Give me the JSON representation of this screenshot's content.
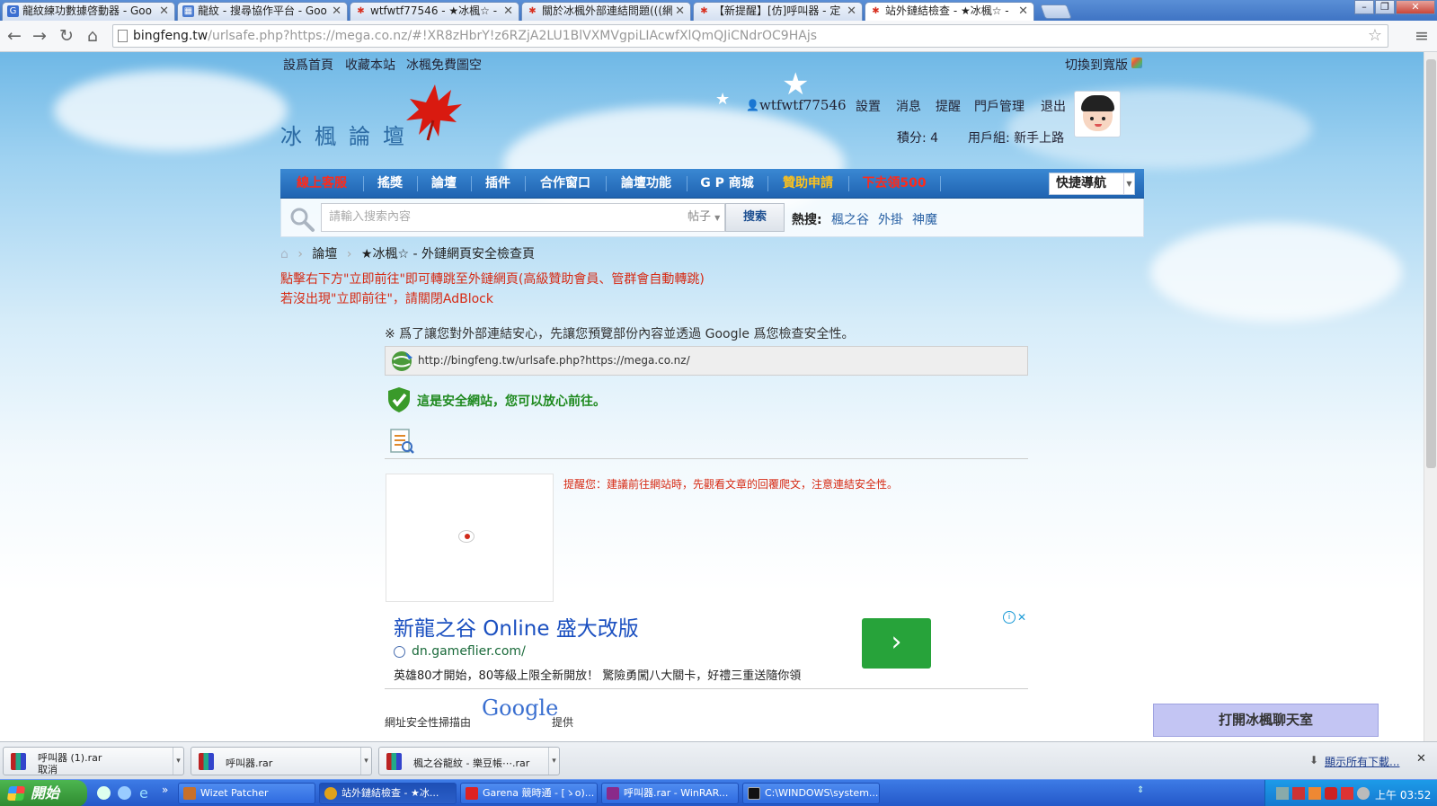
{
  "browser": {
    "tabs": [
      {
        "label": "龍紋練功數據啓動器 - Goo",
        "favicon": "G",
        "favcolor": "#3b6fd1"
      },
      {
        "label": "龍紋 - 搜尋協作平台 - Goo",
        "favicon": "▦",
        "favcolor": "#4a7bd0"
      },
      {
        "label": "wtfwtf77546 - ★冰楓☆ - 網",
        "favicon": "✱",
        "favcolor": "#d83020"
      },
      {
        "label": "關於冰楓外部連結問題(((網",
        "favicon": "✱",
        "favcolor": "#d83020"
      },
      {
        "label": "【新提醒】[仿]呼叫器 - 定",
        "favicon": "✱",
        "favcolor": "#d83020"
      },
      {
        "label": "站外鏈結檢查 - ★冰楓☆ -",
        "favicon": "✱",
        "favcolor": "#d83020"
      }
    ],
    "address_host": "bingfeng.tw",
    "address_path": "/urlsafe.php?https://mega.co.nz/#!XR8zHbrY!z6RZjA2LU1BlVXMVgpiLIAcwfXlQmQJiCNdrOC9HAjs"
  },
  "site": {
    "top_links": [
      "設爲首頁",
      "收藏本站",
      "冰楓免費圖空"
    ],
    "switch_wide": "切換到寬版",
    "logo_text": "冰楓論壇",
    "username": "wtfwtf77546",
    "user_links": [
      "設置",
      "消息",
      "提醒",
      "門戶管理",
      "退出"
    ],
    "points_label": "積分: 4",
    "user_group": "用戶組: 新手上路",
    "nav": [
      {
        "label": "線上客服",
        "color": "#ff2a1a"
      },
      {
        "label": "搖獎",
        "color": "#ffffff"
      },
      {
        "label": "論壇",
        "color": "#ffffff"
      },
      {
        "label": "插件",
        "color": "#ffffff"
      },
      {
        "label": "合作窗口",
        "color": "#ffffff"
      },
      {
        "label": "論壇功能",
        "color": "#ffffff"
      },
      {
        "label": "G P 商城",
        "color": "#ffffff"
      },
      {
        "label": "贊助申請",
        "color": "#ffc21a"
      },
      {
        "label": "下去領500",
        "color": "#ff2a1a"
      }
    ],
    "quick_nav": "快捷導航",
    "search_placeholder": "請輸入搜索內容",
    "search_type": "帖子",
    "search_button": "搜索",
    "hot_label": "熱搜:",
    "hot_terms": [
      "楓之谷",
      "外掛",
      "神魔"
    ],
    "breadcrumb": [
      "論壇",
      "★冰楓☆ - 外鏈網頁安全檢查頁"
    ],
    "notice_line1": "點擊右下方\"立即前往\"即可轉跳至外鏈網頁(高級贊助會員、管群會自動轉跳)",
    "notice_line2": "若沒出現\"立即前往\"，請關閉AdBlock",
    "intro": "※ 爲了讓您對外部連結安心，先讓您預覽部份內容並透過 Google 爲您檢查安全性。",
    "checked_url": "http://bingfeng.tw/urlsafe.php?https://mega.co.nz/",
    "safe_text": "這是安全網站，您可以放心前往。",
    "reminder": "提醒您：建議前往網站時，先觀看文章的回覆爬文，注意連結安全性。",
    "ad": {
      "title": "新龍之谷 Online 盛大改版",
      "url": "dn.gameflier.com/",
      "desc": "英雄80才開始，80等級上限全新開放！ 驚險勇闖八大關卡，好禮三重送隨你領"
    },
    "google_credit_prefix": "網址安全性掃描由",
    "google_logo": "Google",
    "google_credit_suffix": "提供",
    "chat_button": "打開冰楓聊天室"
  },
  "downloads": {
    "items": [
      {
        "name": "呼叫器 (1).rar",
        "status": "取消"
      },
      {
        "name": "呼叫器.rar",
        "status": ""
      },
      {
        "name": "楓之谷龍紋 - 樂豆帳⋯.rar",
        "status": ""
      }
    ],
    "show_all": "顯示所有下載..."
  },
  "taskbar": {
    "start": "開始",
    "tasks": [
      {
        "label": "Wizet Patcher",
        "color": "#c8702a"
      },
      {
        "label": "站外鏈結檢查 - ★冰...",
        "color": "#e0a21a"
      },
      {
        "label": "Garena 競時通 - [ゝo)...",
        "color": "#d22"
      },
      {
        "label": "呼叫器.rar - WinRAR...",
        "color": "#8a2a8a"
      },
      {
        "label": "C:\\WINDOWS\\system...",
        "color": "#111"
      }
    ],
    "clock": "上午 03:52"
  },
  "colors": {
    "accent": "#1f63b1",
    "notice_red": "#d62a14",
    "safe_green": "#1f8a1f"
  }
}
